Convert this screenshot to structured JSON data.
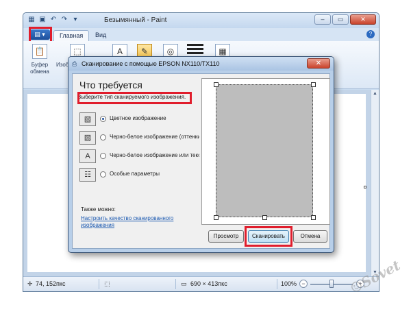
{
  "window": {
    "title": "Безымянный - Paint",
    "controls": {
      "minimize": "–",
      "maximize": "▭",
      "close": "✕"
    }
  },
  "ribbon": {
    "tabs": [
      {
        "label": "Главная",
        "active": true
      },
      {
        "label": "Вид",
        "active": false
      }
    ],
    "groups": {
      "clipboard": "Буфер обмена",
      "image_partial": "Изоб"
    }
  },
  "dialog": {
    "title": "Сканирование с помощью EPSON NX110/TX110",
    "heading": "Что требуется",
    "prompt": "Выберите тип сканируемого изображения.",
    "options": [
      {
        "label": "Цветное изображение",
        "selected": true,
        "icon": "color-photo-icon"
      },
      {
        "label": "Черно-белое изображение (оттенки серого)",
        "selected": false,
        "icon": "grayscale-photo-icon"
      },
      {
        "label": "Черно-белое изображение или текст",
        "selected": false,
        "icon": "text-document-icon"
      },
      {
        "label": "Особые параметры",
        "selected": false,
        "icon": "custom-settings-icon"
      }
    ],
    "also_label": "Также можно:",
    "adjust_link": "Настроить качество сканированного изображения",
    "buttons": {
      "preview": "Просмотр",
      "scan": "Сканировать",
      "cancel": "Отмена"
    }
  },
  "statusbar": {
    "cursor_position": "74, 152пкс",
    "image_size": "690 × 413пкс",
    "zoom": "100%"
  },
  "colors": {
    "highlight": "#e01d2c",
    "link": "#1a58b0"
  }
}
